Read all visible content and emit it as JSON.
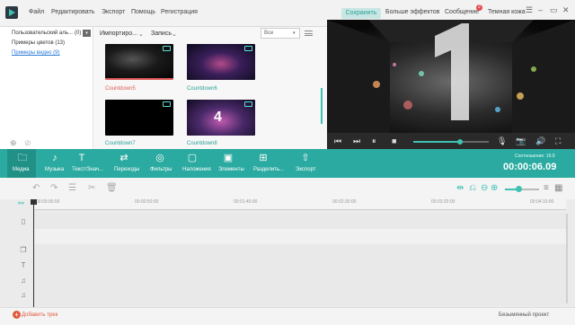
{
  "menu": {
    "file": "Файл",
    "edit": "Редактировать",
    "export": "Экспорт",
    "help": "Помощь",
    "register": "Регистрация"
  },
  "header": {
    "save": "Сохранить",
    "more_effects": "Больше эффектов",
    "messages": "Сообщение",
    "messages_badge": "2",
    "theme": "Темная кожа"
  },
  "library": {
    "user_album": "Пользовательский аль...",
    "user_album_count": "(0)",
    "color_samples": "Примеры цветов (13)",
    "video_samples": "Примеры видео (9)"
  },
  "media_toolbar": {
    "import": "Импортиро...",
    "record": "Запись",
    "filter_value": "Все"
  },
  "media_items": [
    {
      "label": "Countdown5",
      "selected": true
    },
    {
      "label": "Countdown6",
      "selected": false
    },
    {
      "label": "Countdown7",
      "selected": false
    },
    {
      "label": "Countdown8",
      "selected": false
    }
  ],
  "tabs": [
    {
      "label": "Медиа",
      "icon": "folder-icon"
    },
    {
      "label": "Музыка",
      "icon": "music-note-icon"
    },
    {
      "label": "Текст/Знач...",
      "icon": "text-icon"
    },
    {
      "label": "Переходы",
      "icon": "transition-icon"
    },
    {
      "label": "Фильтры",
      "icon": "filter-icon"
    },
    {
      "label": "Наложения",
      "icon": "overlay-icon"
    },
    {
      "label": "Элементы",
      "icon": "image-icon"
    },
    {
      "label": "Разделить...",
      "icon": "split-screen-icon"
    },
    {
      "label": "Экспорт",
      "icon": "export-icon"
    }
  ],
  "preview": {
    "ratio_label": "Соотношение: 16:9",
    "timecode": "00:00:06.09",
    "progress": 0.62
  },
  "timeline": {
    "ruler": [
      "00:00:00:00",
      "00:00:50:00",
      "00:01:40:00",
      "00:02:30:00",
      "00:03:20:00",
      "00:04:10:00"
    ],
    "zoom": 0.35
  },
  "footer": {
    "add_track": "Добавить трек",
    "project": "Безымянный проект"
  },
  "colors": {
    "accent": "#2aaaa0",
    "selected_label": "#e05a5a",
    "thumb_label": "#2aa197"
  }
}
